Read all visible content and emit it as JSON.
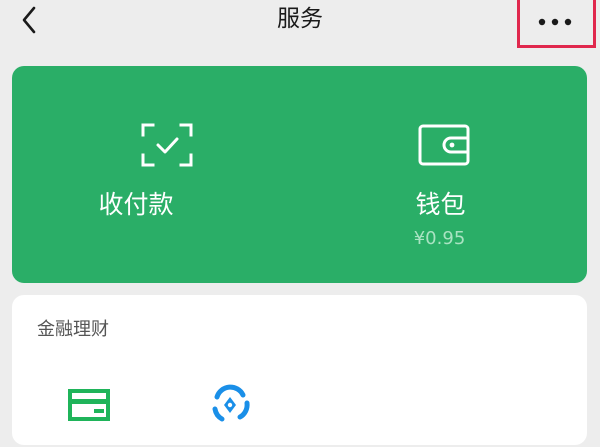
{
  "header": {
    "title": "服务"
  },
  "payment_card": {
    "collect": {
      "label": "收付款",
      "icon": "scan-frame-check-icon"
    },
    "wallet": {
      "label": "钱包",
      "balance": "¥0.95",
      "icon": "wallet-icon"
    }
  },
  "finance": {
    "title": "金融理财",
    "items": [
      {
        "icon": "credit-card-icon"
      },
      {
        "icon": "wealth-fund-icon"
      }
    ]
  },
  "colors": {
    "brand_green": "#2aae67",
    "highlight_red": "#e0284d",
    "background": "#ededed"
  }
}
